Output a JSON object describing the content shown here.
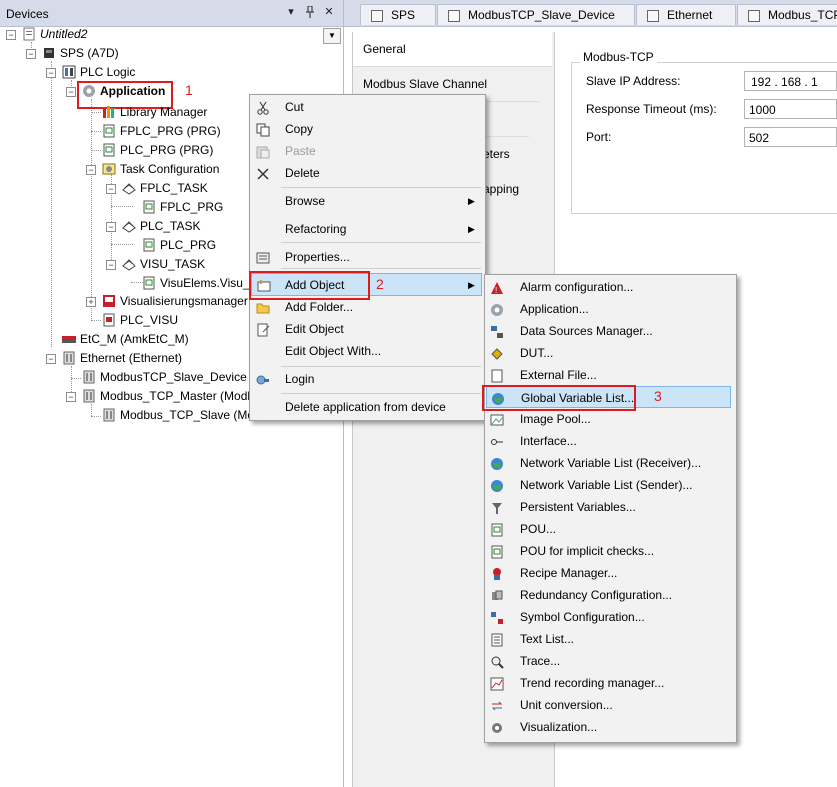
{
  "devices": {
    "title": "Devices",
    "pin_glyph": "▾",
    "pin2_glyph": "ꝑ",
    "close_glyph": "✕",
    "tree": [
      {
        "id": "untitled",
        "label": "Untitled2"
      },
      {
        "id": "sps",
        "label": "SPS (A7D)"
      },
      {
        "id": "plclogic",
        "label": "PLC Logic"
      },
      {
        "id": "application",
        "label": "Application"
      },
      {
        "id": "libmgr",
        "label": "Library Manager"
      },
      {
        "id": "fplcprg",
        "label": "FPLC_PRG (PRG)"
      },
      {
        "id": "plcprg",
        "label": "PLC_PRG (PRG)"
      },
      {
        "id": "taskcfg",
        "label": "Task Configuration"
      },
      {
        "id": "fplctask",
        "label": "FPLC_TASK"
      },
      {
        "id": "fplctask_prg",
        "label": "FPLC_PRG"
      },
      {
        "id": "plctask",
        "label": "PLC_TASK"
      },
      {
        "id": "plctask_prg",
        "label": "PLC_PRG"
      },
      {
        "id": "visutask",
        "label": "VISU_TASK"
      },
      {
        "id": "visuelems",
        "label": "VisuElems.Visu_Prg"
      },
      {
        "id": "visumgr",
        "label": "Visualisierungsmanager"
      },
      {
        "id": "plcvisu",
        "label": "PLC_VISU"
      },
      {
        "id": "etcm",
        "label": "EtC_M (AmkEtC_M)"
      },
      {
        "id": "ethernet",
        "label": "Ethernet (Ethernet)"
      },
      {
        "id": "mbslavedev",
        "label": "ModbusTCP_Slave_Device (Mod"
      },
      {
        "id": "mbmaster",
        "label": "Modbus_TCP_Master (Modbus"
      },
      {
        "id": "mbslave",
        "label": "Modbus_TCP_Slave (Modbus"
      }
    ]
  },
  "annotations": {
    "step1": "1",
    "step2": "2",
    "step3": "3"
  },
  "tabs": [
    {
      "label": "SPS"
    },
    {
      "label": "ModbusTCP_Slave_Device"
    },
    {
      "label": "Ethernet"
    },
    {
      "label": "Modbus_TCP_"
    }
  ],
  "side_tabs": [
    {
      "label": "General"
    },
    {
      "label": "Modbus Slave Channel"
    },
    {
      "label": "eters"
    },
    {
      "label": "apping"
    }
  ],
  "modbus": {
    "group_title": "Modbus-TCP",
    "ip_label": "Slave IP Address:",
    "ip_value": "192 . 168 . 1",
    "timeout_label": "Response Timeout (ms):",
    "timeout_value": "1000",
    "port_label": "Port:",
    "port_value": "502"
  },
  "context_menu": {
    "items": [
      {
        "label": "Cut",
        "icon": "scissors-icon",
        "enabled": true
      },
      {
        "label": "Copy",
        "icon": "copy-icon",
        "enabled": true
      },
      {
        "label": "Paste",
        "icon": "paste-icon",
        "enabled": false
      },
      {
        "label": "Delete",
        "icon": "delete-icon",
        "enabled": true
      },
      {
        "label": "Browse",
        "submenu": true
      },
      {
        "label": "Refactoring",
        "submenu": true
      },
      {
        "label": "Properties...",
        "icon": "properties-icon"
      },
      {
        "label": "Add Object",
        "icon": "add-object-icon",
        "submenu": true,
        "highlighted": true
      },
      {
        "label": "Add Folder...",
        "icon": "folder-icon"
      },
      {
        "label": "Edit Object",
        "icon": "edit-object-icon"
      },
      {
        "label": "Edit Object With..."
      },
      {
        "label": "Login",
        "icon": "login-icon"
      },
      {
        "label": "Delete application from device"
      }
    ]
  },
  "submenu": {
    "items": [
      {
        "label": "Alarm configuration...",
        "icon": "alarm-icon"
      },
      {
        "label": "Application...",
        "icon": "application-icon"
      },
      {
        "label": "Data Sources Manager...",
        "icon": "data-sources-icon"
      },
      {
        "label": "DUT...",
        "icon": "dut-icon"
      },
      {
        "label": "External File...",
        "icon": "external-file-icon"
      },
      {
        "label": "Global Variable List...",
        "icon": "globe-icon",
        "highlighted": true
      },
      {
        "label": "Image Pool...",
        "icon": "image-pool-icon"
      },
      {
        "label": "Interface...",
        "icon": "interface-icon"
      },
      {
        "label": "Network Variable List (Receiver)...",
        "icon": "globe-icon"
      },
      {
        "label": "Network Variable List (Sender)...",
        "icon": "globe-icon"
      },
      {
        "label": "Persistent Variables...",
        "icon": "persistent-icon"
      },
      {
        "label": "POU...",
        "icon": "pou-icon"
      },
      {
        "label": "POU for implicit checks...",
        "icon": "pou-icon"
      },
      {
        "label": "Recipe Manager...",
        "icon": "recipe-icon"
      },
      {
        "label": "Redundancy Configuration...",
        "icon": "redundancy-icon"
      },
      {
        "label": "Symbol Configuration...",
        "icon": "symbol-icon"
      },
      {
        "label": "Text List...",
        "icon": "text-list-icon"
      },
      {
        "label": "Trace...",
        "icon": "trace-icon"
      },
      {
        "label": "Trend recording manager...",
        "icon": "trend-icon"
      },
      {
        "label": "Unit conversion...",
        "icon": "unit-conversion-icon"
      },
      {
        "label": "Visualization...",
        "icon": "visualization-icon"
      }
    ]
  },
  "colors": {
    "highlight": "#cce4f7",
    "annotation": "#e01b1b",
    "header": "#d6dbe9"
  }
}
